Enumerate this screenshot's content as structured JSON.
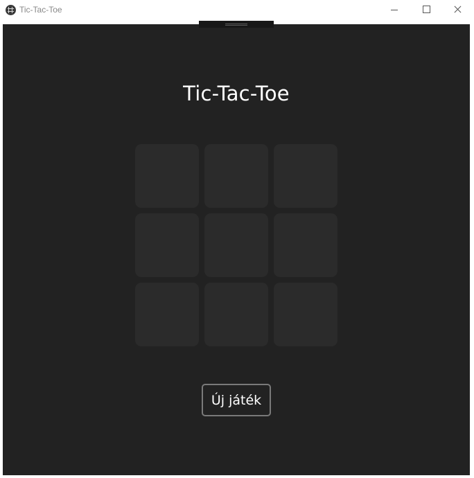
{
  "window": {
    "title": "Tic-Tac-Toe",
    "icon": "app-icon"
  },
  "game": {
    "title": "Tic-Tac-Toe",
    "board": [
      "",
      "",
      "",
      "",
      "",
      "",
      "",
      "",
      ""
    ],
    "new_game_label": "Új játék"
  },
  "colors": {
    "background": "#222222",
    "cell": "#2b2b2b",
    "text": "#ffffff",
    "button_border": "#7a7a7a"
  }
}
